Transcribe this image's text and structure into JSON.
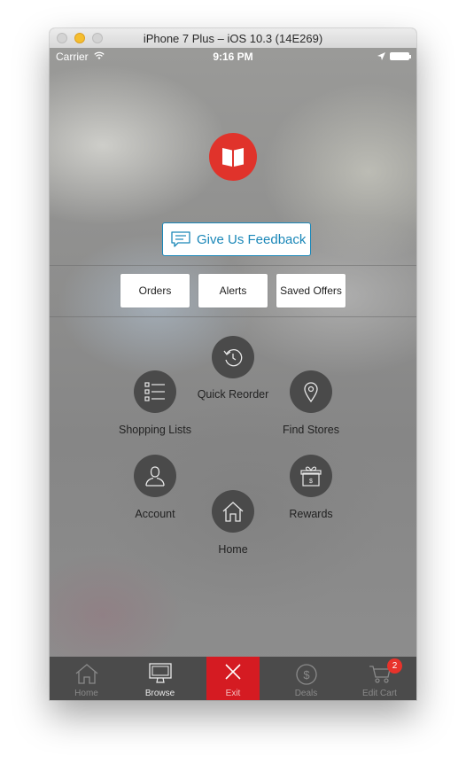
{
  "window": {
    "title": "iPhone 7 Plus – iOS 10.3 (14E269)"
  },
  "status_bar": {
    "carrier": "Carrier",
    "time": "9:16 PM"
  },
  "feedback_button": {
    "label": "Give Us Feedback"
  },
  "top_buttons": {
    "orders": "Orders",
    "alerts": "Alerts",
    "saved_offers": "Saved Offers"
  },
  "radial_menu": {
    "quick_reorder": "Quick Reorder",
    "shopping_lists": "Shopping Lists",
    "find_stores": "Find Stores",
    "account": "Account",
    "rewards": "Rewards",
    "home": "Home"
  },
  "tab_bar": {
    "home": "Home",
    "browse": "Browse",
    "exit": "Exit",
    "deals": "Deals",
    "edit_cart": "Edit Cart",
    "cart_badge": "2",
    "active": "Browse"
  },
  "colors": {
    "brand_red": "#e0332b",
    "exit_red": "#d51b22",
    "feedback_blue": "#1a87b8",
    "tab_bg": "#4b4b4b"
  }
}
